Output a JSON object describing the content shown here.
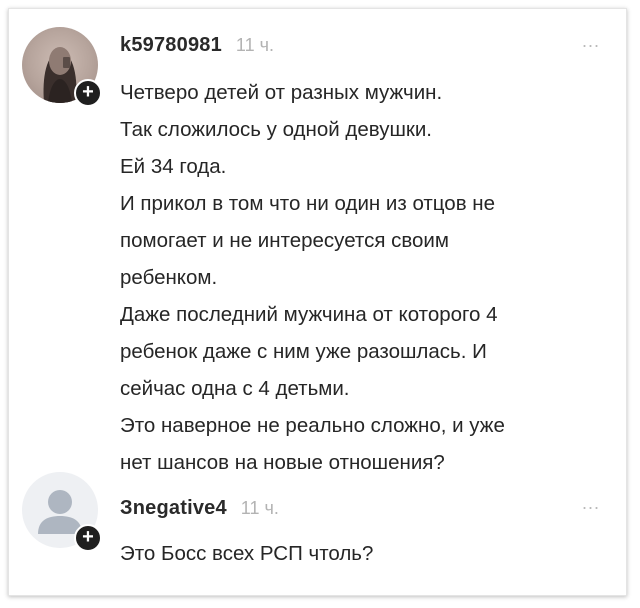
{
  "comments": [
    {
      "author": "k59780981",
      "time": "11 ч.",
      "more": "...",
      "add": "+",
      "lines": [
        "Четверо детей от разных мужчин.",
        "Так сложилось у одной девушки.",
        "Ей 34 года.",
        "И прикол в том что ни один из отцов не",
        "помогает и не интересуется своим",
        "ребенком.",
        "Даже последний мужчина от которого 4",
        "ребенок даже с ним уже разошлась. И",
        "сейчас одна с 4 детьми.",
        "Это наверное не реально сложно, и уже",
        "нет шансов на новые отношения?"
      ]
    },
    {
      "author": "Зnegative4",
      "time": "11 ч.",
      "more": "...",
      "add": "+",
      "lines": [
        "Это Босс всех РСП чтоль?"
      ]
    }
  ],
  "colors": {
    "plus_badge": "#1f1f1f",
    "time": "#b3b3b3",
    "text": "#262626"
  }
}
